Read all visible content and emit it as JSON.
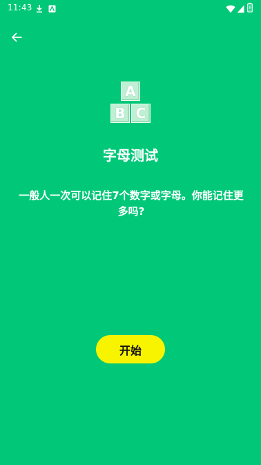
{
  "status_bar": {
    "time": "11:43",
    "icons": [
      "download-icon",
      "notification-icon",
      "wifi-icon",
      "signal-icon",
      "battery-icon"
    ]
  },
  "nav": {
    "back_icon": "arrow-left-icon"
  },
  "hero": {
    "icon": "abc-blocks-icon",
    "blocks": [
      "A",
      "B",
      "C"
    ]
  },
  "title": "字母测试",
  "description": "一般人一次可以记住7个数字或字母。你能记住更多吗?",
  "start_button_label": "开始",
  "colors": {
    "background": "#00c878",
    "button": "#f8f400",
    "button_text": "#111111",
    "text": "#ffffff"
  }
}
